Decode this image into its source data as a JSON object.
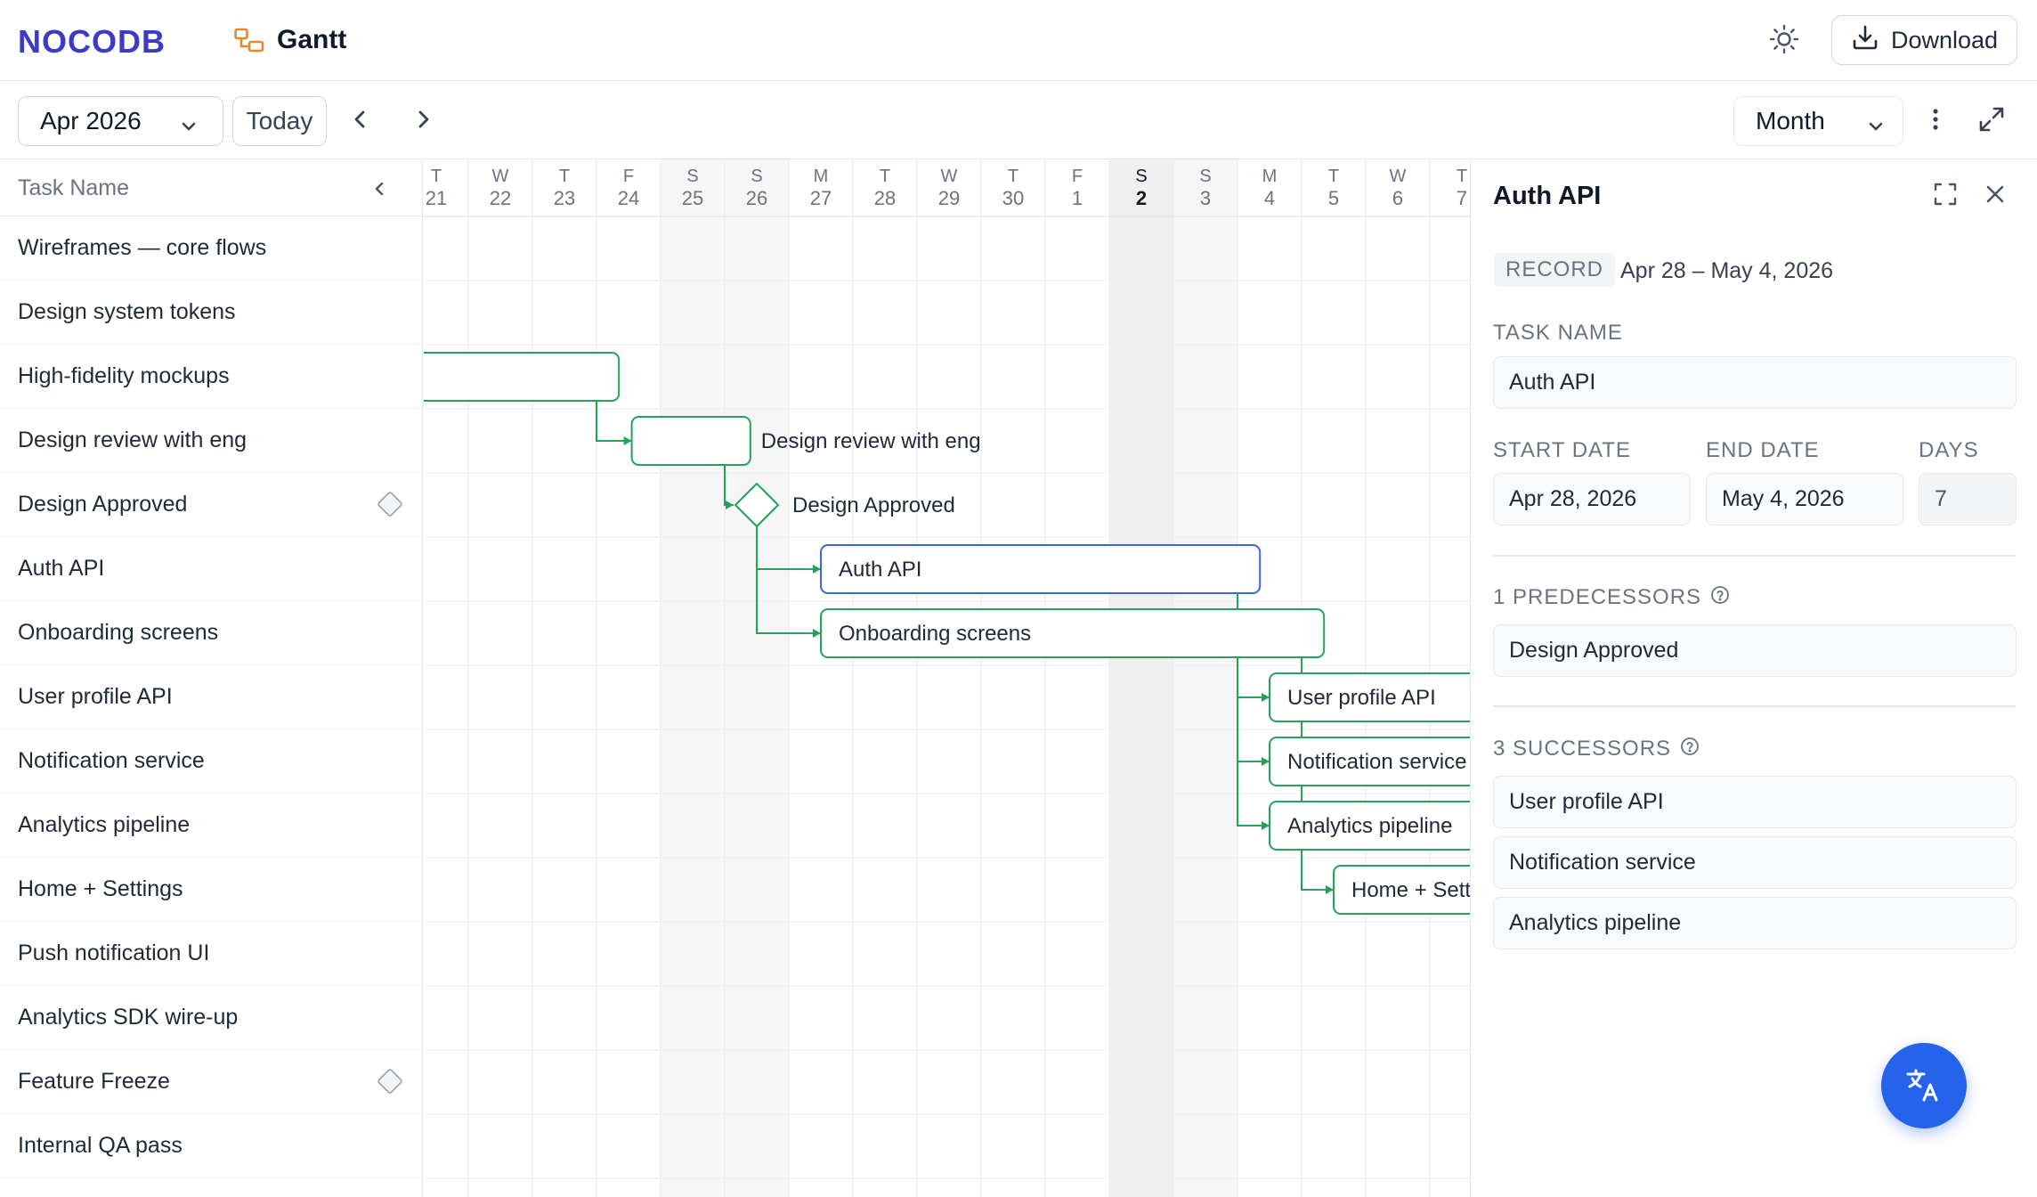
{
  "app": {
    "logo_text": "NOCODB",
    "view_title": "Gantt"
  },
  "header": {
    "download_label": "Download"
  },
  "toolbar": {
    "month_label": "Apr 2026",
    "today_label": "Today",
    "scale_label": "Month"
  },
  "tasklist": {
    "header_label": "Task Name",
    "rows": [
      {
        "name": "Wireframes — core flows",
        "milestone": false
      },
      {
        "name": "Design system tokens",
        "milestone": false
      },
      {
        "name": "High-fidelity mockups",
        "milestone": false
      },
      {
        "name": "Design review with eng",
        "milestone": false
      },
      {
        "name": "Design Approved",
        "milestone": true
      },
      {
        "name": "Auth API",
        "milestone": false
      },
      {
        "name": "Onboarding screens",
        "milestone": false
      },
      {
        "name": "User profile API",
        "milestone": false
      },
      {
        "name": "Notification service",
        "milestone": false
      },
      {
        "name": "Analytics pipeline",
        "milestone": false
      },
      {
        "name": "Home + Settings",
        "milestone": false
      },
      {
        "name": "Push notification UI",
        "milestone": false
      },
      {
        "name": "Analytics SDK wire-up",
        "milestone": false
      },
      {
        "name": "Feature Freeze",
        "milestone": true
      },
      {
        "name": "Internal QA pass",
        "milestone": false
      }
    ]
  },
  "timeline": {
    "days": [
      {
        "dow": "T",
        "day": "21"
      },
      {
        "dow": "W",
        "day": "22"
      },
      {
        "dow": "T",
        "day": "23"
      },
      {
        "dow": "F",
        "day": "24"
      },
      {
        "dow": "S",
        "day": "25",
        "weekend": true
      },
      {
        "dow": "S",
        "day": "26",
        "weekend": true
      },
      {
        "dow": "M",
        "day": "27"
      },
      {
        "dow": "T",
        "day": "28"
      },
      {
        "dow": "W",
        "day": "29"
      },
      {
        "dow": "T",
        "day": "30"
      },
      {
        "dow": "F",
        "day": "1"
      },
      {
        "dow": "S",
        "day": "2",
        "weekend": true,
        "today": true
      },
      {
        "dow": "S",
        "day": "3",
        "weekend": true
      },
      {
        "dow": "M",
        "day": "4"
      },
      {
        "dow": "T",
        "day": "5"
      },
      {
        "dow": "W",
        "day": "6"
      },
      {
        "dow": "T",
        "day": "7"
      }
    ],
    "bars": [
      {
        "row": 2,
        "start": -1,
        "end": 3.35,
        "label": "",
        "label_outside": false
      },
      {
        "row": 3,
        "start": 3.55,
        "end": 5.4,
        "label": "Design review with eng",
        "label_outside": true
      },
      {
        "row": 4,
        "milestone": true,
        "at": 5.5,
        "label": "Design Approved"
      },
      {
        "row": 5,
        "start": 6.5,
        "end": 13.35,
        "label": "Auth API",
        "selected": true
      },
      {
        "row": 6,
        "start": 6.5,
        "end": 14.35,
        "label": "Onboarding screens"
      },
      {
        "row": 7,
        "start": 13.5,
        "end": 18,
        "label": "User profile API"
      },
      {
        "row": 8,
        "start": 13.5,
        "end": 18,
        "label": "Notification service"
      },
      {
        "row": 9,
        "start": 13.5,
        "end": 18,
        "label": "Analytics pipeline"
      },
      {
        "row": 10,
        "start": 14.5,
        "end": 18,
        "label": "Home + Settings"
      }
    ],
    "colors": {
      "bar_border": "#22a35a",
      "selected_border": "#3b66e0",
      "weekend_bg": "#f6f6f7",
      "today_bg": "#f0f0f1"
    }
  },
  "panel": {
    "title": "Auth API",
    "record_badge": "RECORD",
    "record_range": "Apr 28 – May 4, 2026",
    "task_name_label": "TASK NAME",
    "task_name_value": "Auth API",
    "start_label": "START DATE",
    "start_value": "Apr 28, 2026",
    "end_label": "END DATE",
    "end_value": "May 4, 2026",
    "days_label": "DAYS",
    "days_value": "7",
    "predecessors_label": "1 PREDECESSORS",
    "predecessors": [
      "Design Approved"
    ],
    "successors_label": "3 SUCCESSORS",
    "successors": [
      "User profile API",
      "Notification service",
      "Analytics pipeline"
    ]
  }
}
